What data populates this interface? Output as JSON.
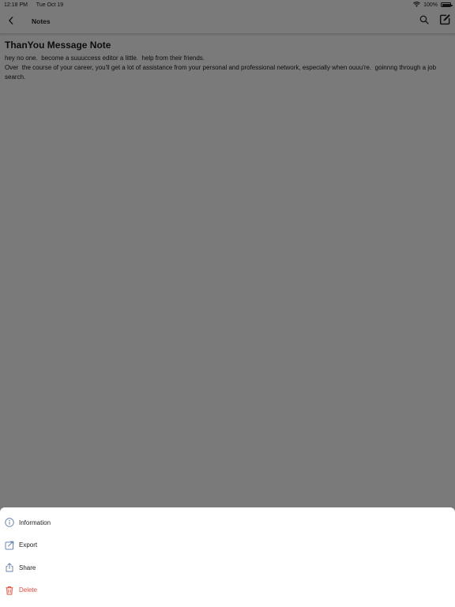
{
  "status_bar": {
    "time": "12:18 PM",
    "date": "Tue Oct 19",
    "battery_percent": "100%",
    "battery_level": 1.0,
    "icons": [
      "wifi-icon",
      "battery-icon"
    ]
  },
  "nav": {
    "title": "Notes",
    "icons": [
      "chevron-left-icon",
      "search-icon",
      "compose-icon"
    ]
  },
  "note": {
    "title": "ThanYou Message Note",
    "body": "hey no one.  become a suuuccess editor a little.  help from their friends.\nOver  the course of your career, you'll get a lot of assistance from your personal and professional network, especially when ouuu're.  goinnng through a job search."
  },
  "action_sheet": {
    "items": [
      {
        "label": "Information",
        "icon": "info-icon"
      },
      {
        "label": "Export",
        "icon": "export-icon"
      },
      {
        "label": "Share",
        "icon": "share-icon"
      },
      {
        "label": "Delete",
        "icon": "trash-icon"
      }
    ]
  },
  "colors": {
    "overlay_background": "#7a7a7a",
    "sheet_background": "#ffffff",
    "icon_blue": "#6a86b8",
    "delete_red": "#e84b3c"
  }
}
